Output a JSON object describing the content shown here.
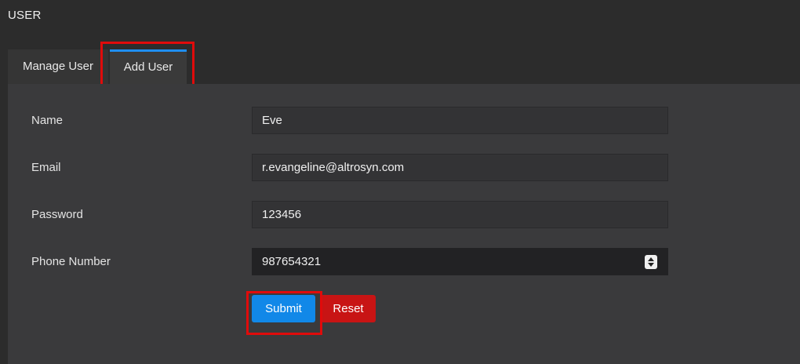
{
  "header": {
    "title": "USER"
  },
  "tabs": [
    {
      "label": "Manage User",
      "active": false
    },
    {
      "label": "Add User",
      "active": true
    }
  ],
  "form": {
    "name": {
      "label": "Name",
      "value": "Eve"
    },
    "email": {
      "label": "Email",
      "value": "r.evangeline@altrosyn.com"
    },
    "password": {
      "label": "Password",
      "value": "123456"
    },
    "phone": {
      "label": "Phone Number",
      "value": "987654321"
    }
  },
  "actions": {
    "submit_label": "Submit",
    "reset_label": "Reset"
  },
  "colors": {
    "accent": "#1188e8",
    "danger": "#c81414",
    "highlight": "#e00b0b",
    "panel_bg": "#3a3a3c",
    "page_bg": "#2c2c2c"
  }
}
